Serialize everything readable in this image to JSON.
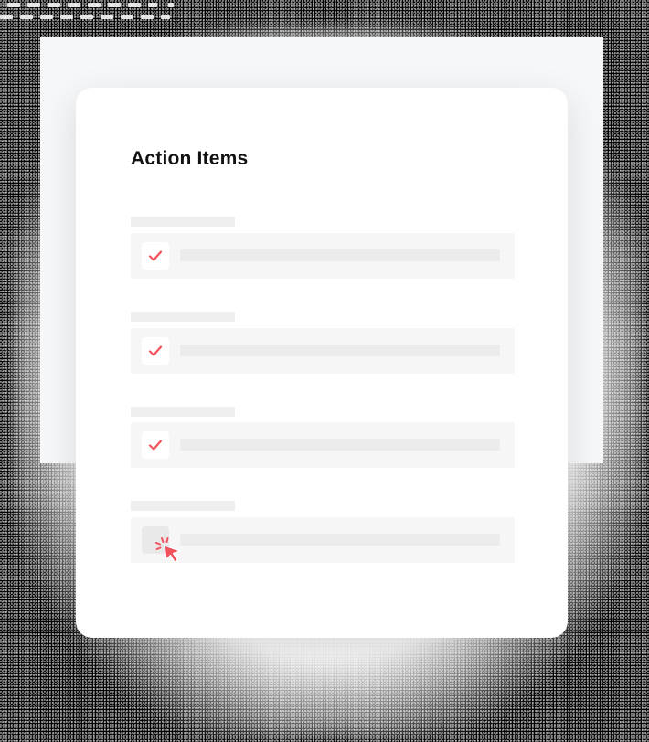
{
  "card": {
    "title": "Action Items"
  },
  "action_items": [
    {
      "checked": true
    },
    {
      "checked": true
    },
    {
      "checked": true
    },
    {
      "checked": false
    }
  ],
  "icons": {
    "check": "check-icon",
    "cursor": "click-cursor-icon"
  },
  "colors": {
    "accent": "#f0535b",
    "background": "#000000",
    "card": "#ffffff",
    "placeholder": "#efefef"
  }
}
